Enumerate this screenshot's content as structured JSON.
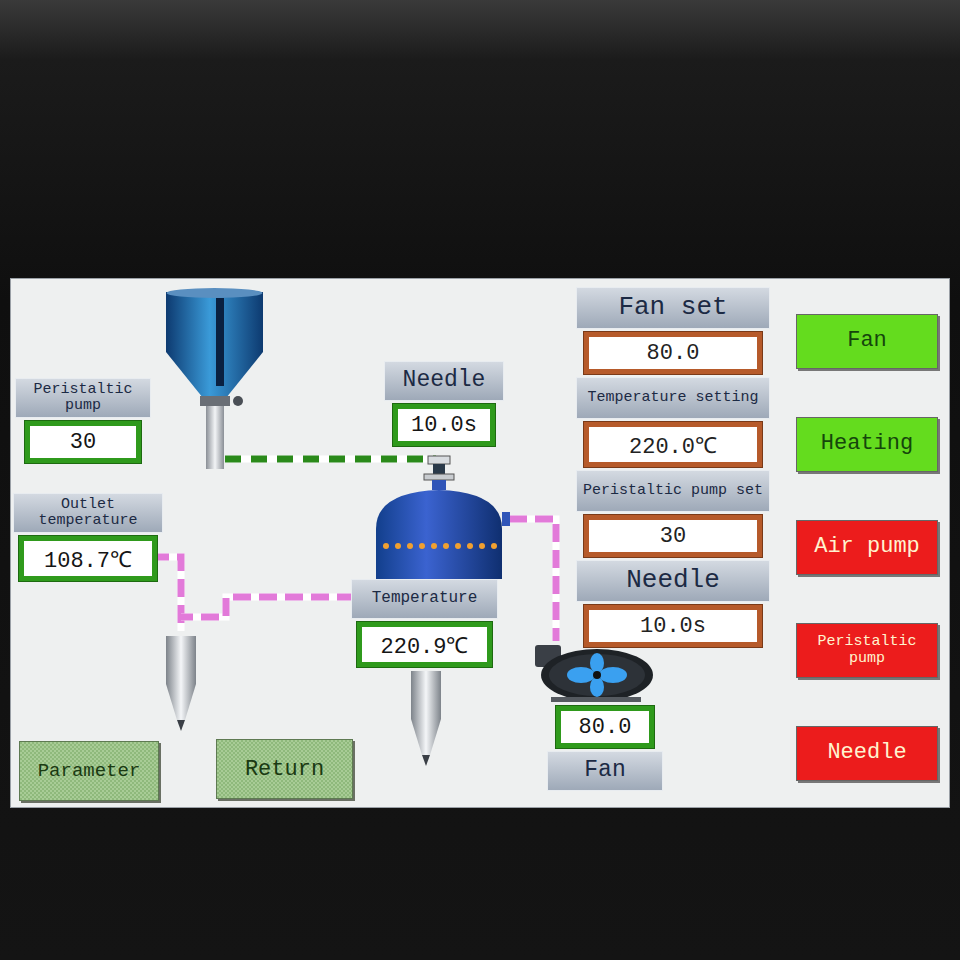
{
  "screen": {
    "diagram": {
      "readouts": [
        {
          "label": "Peristaltic pump",
          "value": "30"
        },
        {
          "label": "Needle",
          "value": "10.0s"
        },
        {
          "label": "Outlet temperature",
          "value": "108.7℃"
        },
        {
          "label": "Temperature",
          "value": "220.9℃"
        },
        {
          "label": "Fan",
          "value": "80.0"
        }
      ]
    },
    "settings": [
      {
        "label": "Fan set",
        "value": "80.0"
      },
      {
        "label": "Temperature setting",
        "value": "220.0℃"
      },
      {
        "label": "Peristaltic pump set",
        "value": "30"
      },
      {
        "label": "Needle",
        "value": "10.0s"
      }
    ],
    "toggles": [
      {
        "label": "Fan",
        "on": true
      },
      {
        "label": "Heating",
        "on": true
      },
      {
        "label": "Air pump",
        "on": false
      },
      {
        "label": "Peristaltic pump",
        "on": false
      },
      {
        "label": "Needle",
        "on": false
      }
    ],
    "nav_buttons": [
      "Parameter",
      "Return"
    ]
  }
}
